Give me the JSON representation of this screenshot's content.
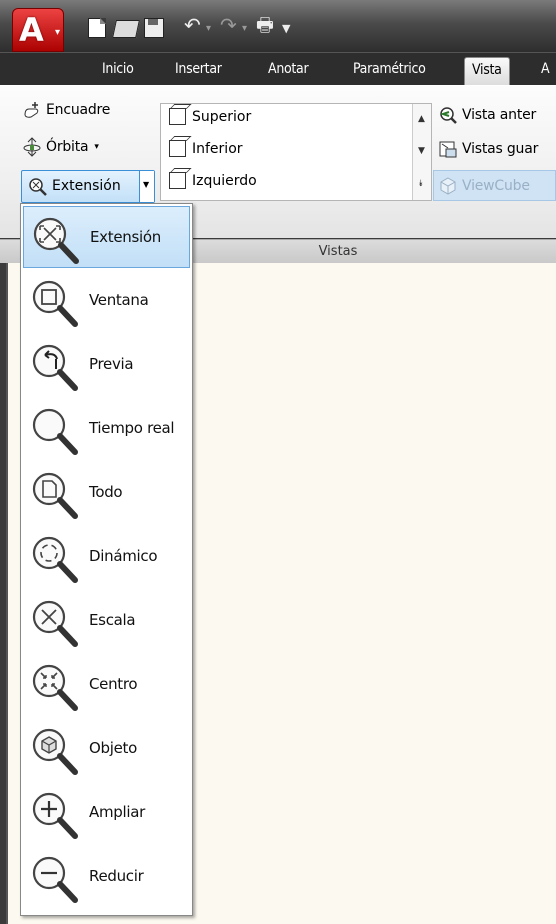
{
  "app": {
    "logo_letter": "A"
  },
  "tabs": [
    {
      "label": "Inicio"
    },
    {
      "label": "Insertar"
    },
    {
      "label": "Anotar"
    },
    {
      "label": "Paramétrico"
    },
    {
      "label": "Vista"
    },
    {
      "label": "A"
    }
  ],
  "ribbon": {
    "nav": {
      "encuadre": "Encuadre",
      "orbita": "Órbita",
      "extension": "Extensión"
    },
    "views_gallery": [
      "Superior",
      "Inferior",
      "Izquierdo"
    ],
    "right_items": {
      "vista_anterior": "Vista anter",
      "vistas_guardadas": "Vistas guar",
      "viewcube": "ViewCube"
    },
    "panel_label": "Vistas"
  },
  "zoom_menu": {
    "selected": "Extensión",
    "items": [
      {
        "label": "Extensión",
        "icon": "zoom-extents-icon"
      },
      {
        "label": "Ventana",
        "icon": "zoom-window-icon"
      },
      {
        "label": "Previa",
        "icon": "zoom-previous-icon"
      },
      {
        "label": "Tiempo real",
        "icon": "zoom-realtime-icon"
      },
      {
        "label": "Todo",
        "icon": "zoom-all-icon"
      },
      {
        "label": "Dinámico",
        "icon": "zoom-dynamic-icon"
      },
      {
        "label": "Escala",
        "icon": "zoom-scale-icon"
      },
      {
        "label": "Centro",
        "icon": "zoom-center-icon"
      },
      {
        "label": "Objeto",
        "icon": "zoom-object-icon"
      },
      {
        "label": "Ampliar",
        "icon": "zoom-in-icon"
      },
      {
        "label": "Reducir",
        "icon": "zoom-out-icon"
      }
    ]
  },
  "colors": {
    "selection": "#c2dff7",
    "canvas": "#fcfaf0",
    "titlebar": "#3b3b3b"
  }
}
